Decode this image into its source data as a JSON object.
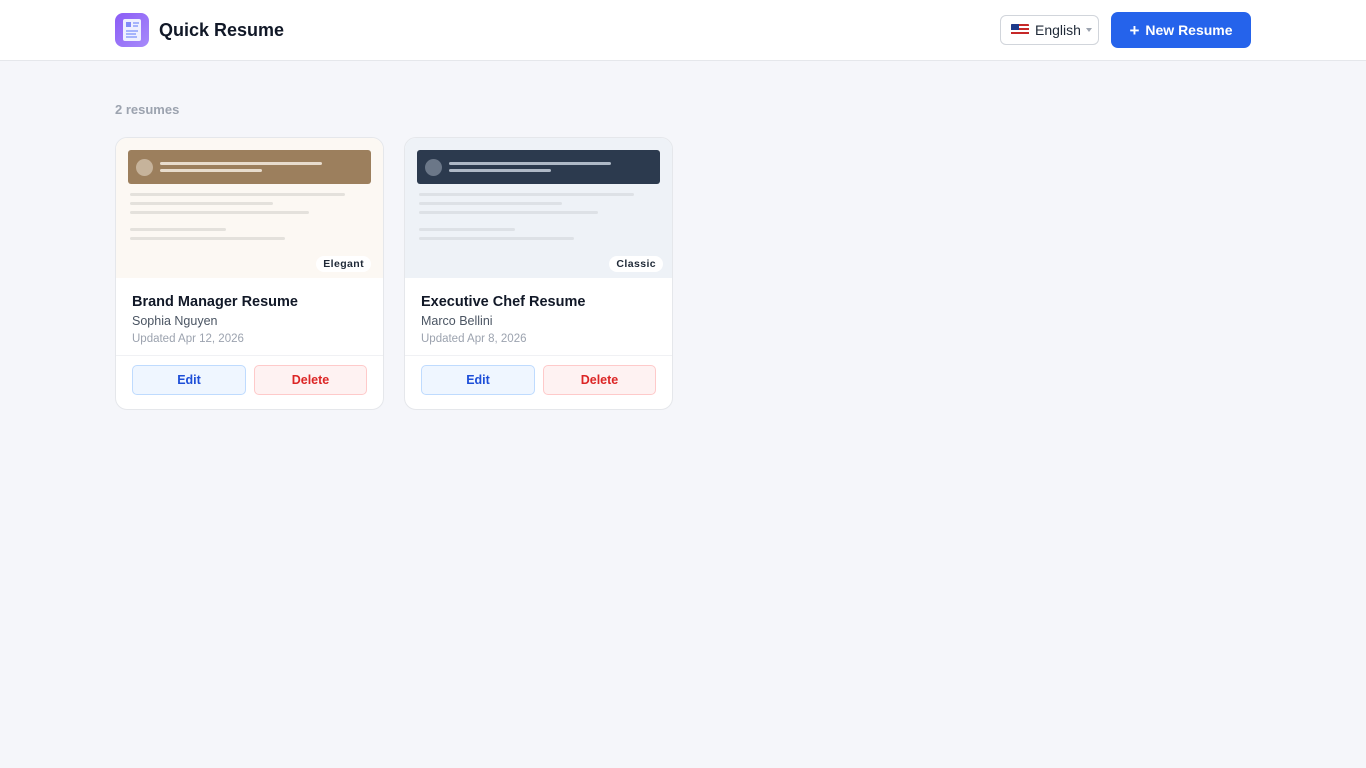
{
  "app": {
    "title": "Quick Resume",
    "logo_icon": "resume-document-icon",
    "accent_color": "#2563eb",
    "logo_color": "#8b5cf6"
  },
  "header": {
    "language": {
      "flag": "🇺🇸",
      "label": "English",
      "icon": "chevron-down-icon"
    },
    "new_button": {
      "icon": "plus-icon",
      "label": "New Resume"
    }
  },
  "list": {
    "count_label": "2 resumes",
    "resumes": [
      {
        "template": "Elegant",
        "title": "Brand Manager Resume",
        "name": "Sophia Nguyen",
        "updated": "Updated Apr 12, 2026",
        "edit_label": "Edit",
        "delete_label": "Delete",
        "preview_background": "#fcf8f3",
        "banner_color": "#9c7f5d"
      },
      {
        "template": "Classic",
        "title": "Executive Chef Resume",
        "name": "Marco Bellini",
        "updated": "Updated Apr 8, 2026",
        "edit_label": "Edit",
        "delete_label": "Delete",
        "preview_background": "#eef2f7",
        "banner_color": "#2c3a4e"
      }
    ]
  }
}
